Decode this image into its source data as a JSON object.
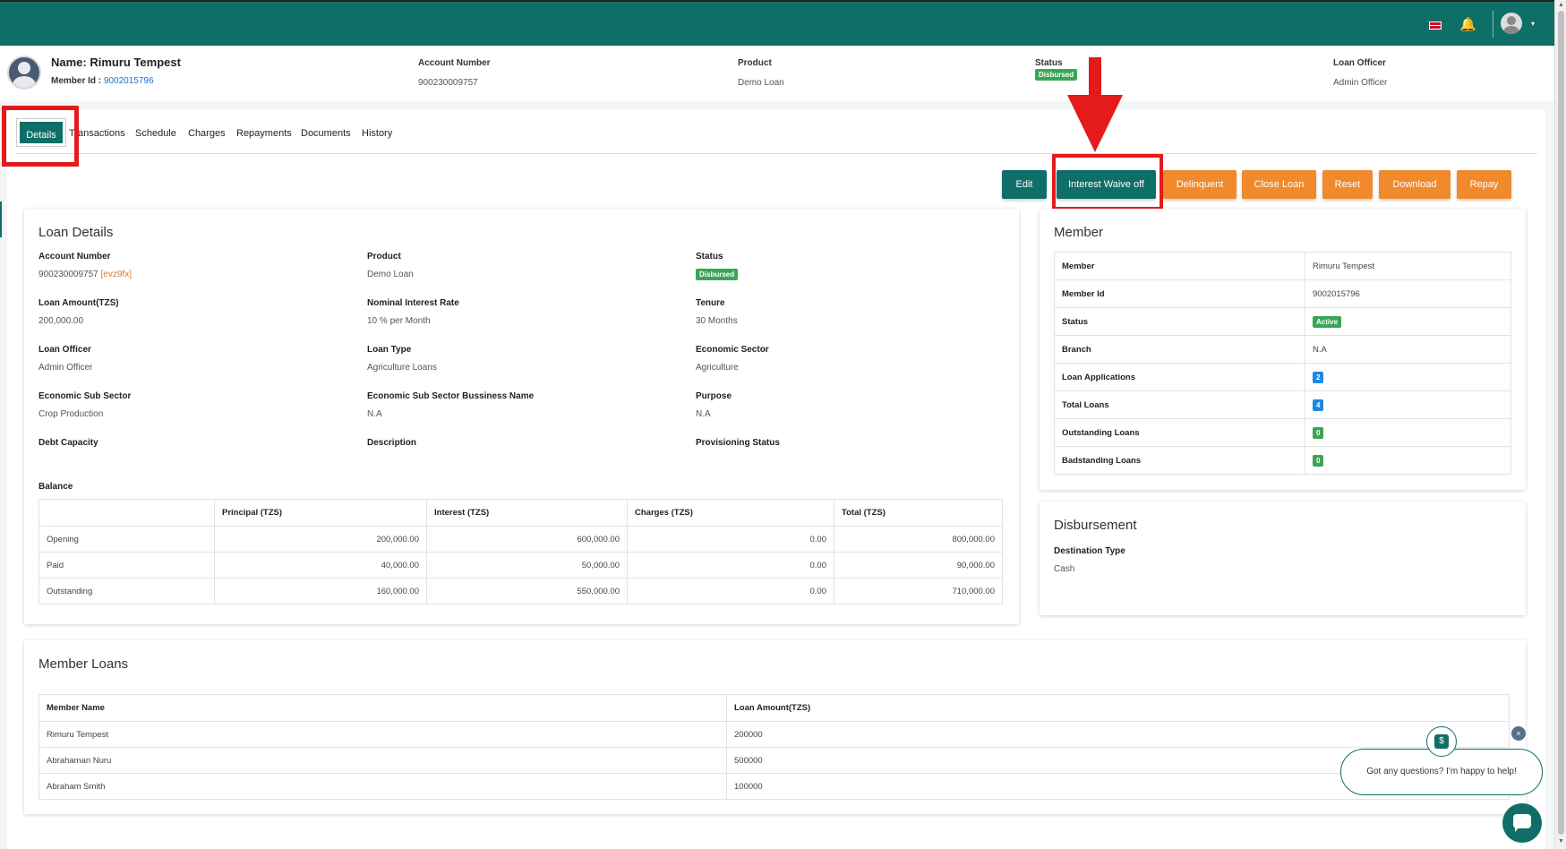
{
  "topbar": {
    "flag_icon": "uk-flag-icon",
    "bell_icon": "bell-icon",
    "avatar_icon": "user-avatar-icon",
    "caret": "▾"
  },
  "header": {
    "name_label": "Name: Rimuru Tempest",
    "member_id_label": "Member Id : ",
    "member_id": "9002015796",
    "account_number_label": "Account Number",
    "account_number": "900230009757",
    "product_label": "Product",
    "product": "Demo Loan",
    "status_label": "Status",
    "status": "Disbursed",
    "loan_officer_label": "Loan Officer",
    "loan_officer": "Admin Officer"
  },
  "tabs": [
    "Details",
    "Transactions",
    "Schedule",
    "Charges",
    "Repayments",
    "Documents",
    "History"
  ],
  "actions": {
    "edit": "Edit",
    "interest_waive_off": "Interest Waive off",
    "delinquent": "Delinquent",
    "close_loan": "Close Loan",
    "reset": "Reset",
    "download": "Download",
    "repay": "Repay"
  },
  "loan_details": {
    "title": "Loan Details",
    "account_number_label": "Account Number",
    "account_number": "900230009757",
    "account_code": "[evz9fx]",
    "product_label": "Product",
    "product": "Demo Loan",
    "status_label": "Status",
    "status": "Disbursed",
    "loan_amount_label": "Loan Amount(TZS)",
    "loan_amount": "200,000.00",
    "interest_rate_label": "Nominal Interest Rate",
    "interest_rate": "10 % per Month",
    "tenure_label": "Tenure",
    "tenure": "30 Months",
    "loan_officer_label": "Loan Officer",
    "loan_officer": "Admin Officer",
    "loan_type_label": "Loan Type",
    "loan_type": "Agriculture Loans",
    "economic_sector_label": "Economic Sector",
    "economic_sector": "Agriculture",
    "sub_sector_label": "Economic Sub Sector",
    "sub_sector": "Crop Production",
    "sub_sector_business_label": "Economic Sub Sector Bussiness Name",
    "sub_sector_business": "N.A",
    "purpose_label": "Purpose",
    "purpose": "N.A",
    "debt_capacity_label": "Debt Capacity",
    "description_label": "Description",
    "provisioning_status_label": "Provisioning Status",
    "balance_label": "Balance",
    "balance_headers": [
      "",
      "Principal (TZS)",
      "Interest (TZS)",
      "Charges (TZS)",
      "Total (TZS)"
    ],
    "balance_rows": [
      [
        "Opening",
        "200,000.00",
        "600,000.00",
        "0.00",
        "800,000.00"
      ],
      [
        "Paid",
        "40,000.00",
        "50,000.00",
        "0.00",
        "90,000.00"
      ],
      [
        "Outstanding",
        "160,000.00",
        "550,000.00",
        "0.00",
        "710,000.00"
      ]
    ]
  },
  "member": {
    "title": "Member",
    "rows": [
      {
        "label": "Member",
        "value": "Rimuru Tempest"
      },
      {
        "label": "Member Id",
        "value": "9002015796"
      },
      {
        "label": "Status",
        "value": "Active"
      },
      {
        "label": "Branch",
        "value": "N.A"
      },
      {
        "label": "Loan Applications",
        "value": "2"
      },
      {
        "label": "Total Loans",
        "value": "4"
      },
      {
        "label": "Outstanding Loans",
        "value": "0"
      },
      {
        "label": "Badstanding Loans",
        "value": "0"
      }
    ]
  },
  "disbursement": {
    "title": "Disbursement",
    "destination_label": "Destination Type",
    "destination": "Cash"
  },
  "member_loans": {
    "title": "Member Loans",
    "headers": [
      "Member Name",
      "Loan Amount(TZS)"
    ],
    "rows": [
      [
        "Rimuru Tempest",
        "200000"
      ],
      [
        "Abrahaman Nuru",
        "500000"
      ],
      [
        "Abraham Smith",
        "100000"
      ]
    ]
  },
  "chat": {
    "message": "Got any questions? I'm happy to help!",
    "close": "×",
    "logo": "$"
  },
  "colors": {
    "primary": "#0f6e68",
    "accent": "#f08a2c",
    "highlight": "#e51a1a",
    "success": "#3aa655",
    "info": "#1e88e5"
  }
}
